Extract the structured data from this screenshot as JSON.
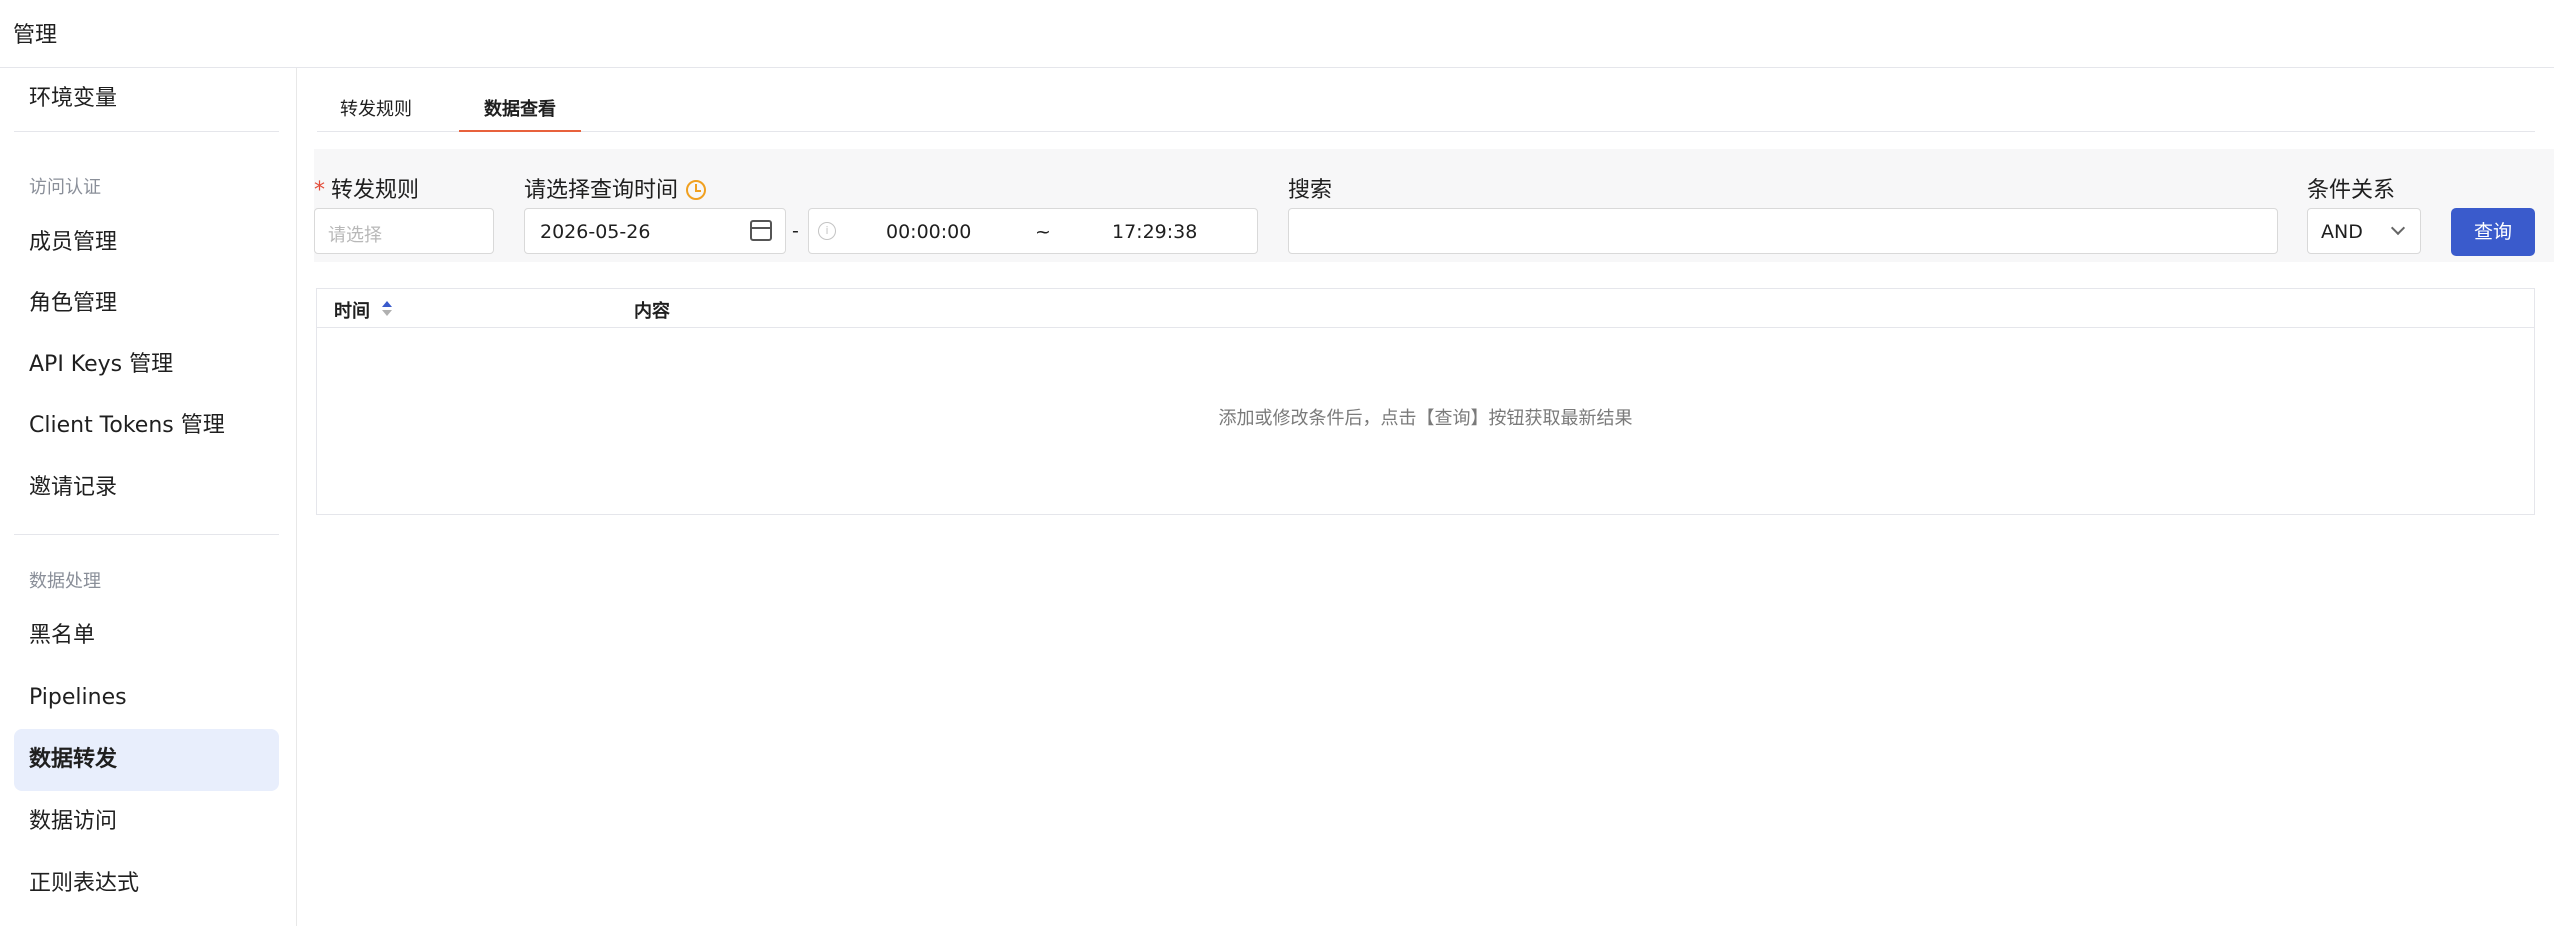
{
  "header": {
    "title": "管理"
  },
  "sidebar": {
    "top_item": "环境变量",
    "groups": [
      {
        "label": "访问认证",
        "items": [
          "成员管理",
          "角色管理",
          "API Keys 管理",
          "Client Tokens 管理",
          "邀请记录"
        ]
      },
      {
        "label": "数据处理",
        "items": [
          "黑名单",
          "Pipelines",
          "数据转发",
          "数据访问",
          "正则表达式"
        ]
      }
    ],
    "active_item": "数据转发"
  },
  "tabs": [
    {
      "label": "转发规则",
      "active": false
    },
    {
      "label": "数据查看",
      "active": true
    }
  ],
  "filters": {
    "rule": {
      "label": "转发规则",
      "required": true,
      "placeholder": "请选择"
    },
    "time": {
      "label": "请选择查询时间",
      "date": "2026-05-26",
      "date_separator": "-",
      "start_time": "00:00:00",
      "range_separator": "~",
      "end_time": "17:29:38"
    },
    "search": {
      "label": "搜索",
      "value": ""
    },
    "condition": {
      "label": "条件关系",
      "value": "AND"
    },
    "query_button": "查询"
  },
  "table": {
    "columns": [
      "时间",
      "内容"
    ],
    "sorted_column": "时间",
    "sort_direction": "ascending",
    "rows": [],
    "empty_message": "添加或修改条件后，点击【查询】按钮获取最新结果"
  },
  "colors": {
    "primary": "#3a5bcc",
    "tab_active_underline": "#e8613c",
    "sidebar_active_bg": "#e8eefc",
    "required_mark": "#e34d3a",
    "clock_icon": "#f0a020"
  },
  "icons": [
    "clock-icon",
    "calendar-icon",
    "info-icon",
    "chevron-down-icon",
    "sort-icon"
  ]
}
